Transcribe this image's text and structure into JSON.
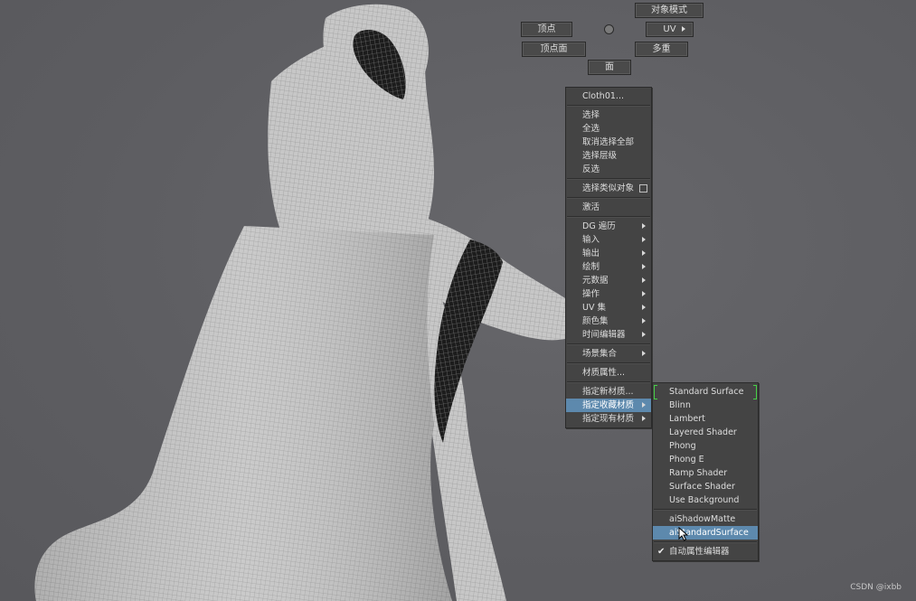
{
  "marking_menu": {
    "object_mode": "对象模式",
    "vertex": "顶点",
    "uv": "UV",
    "vertex_face": "顶点面",
    "multi": "多重",
    "face": "面"
  },
  "context_menu": {
    "header": "Cloth01...",
    "select": "选择",
    "select_all": "全选",
    "deselect_all": "取消选择全部",
    "select_hierarchy": "选择层级",
    "invert": "反选",
    "select_similar": "选择类似对象",
    "activate": "激活",
    "dg_traversal": "DG 遍历",
    "inputs": "输入",
    "outputs": "输出",
    "paint": "绘制",
    "metadata": "元数据",
    "actions": "操作",
    "uv_sets": "UV 集",
    "color_sets": "颜色集",
    "time_editor": "时间编辑器",
    "scene_assembly": "场景集合",
    "material_attributes": "材质属性...",
    "assign_new_material": "指定新材质...",
    "assign_favorite_material": "指定收藏材质",
    "assign_existing_material": "指定现有材质"
  },
  "submenu": {
    "items": [
      "Standard Surface",
      "Blinn",
      "Lambert",
      "Layered Shader",
      "Phong",
      "Phong E",
      "Ramp Shader",
      "Surface Shader",
      "Use Background"
    ],
    "arnold_items": [
      "aiShadowMatte",
      "aiStandardSurface"
    ],
    "auto_attribute_editor": "自动属性编辑器"
  },
  "watermark": "CSDN @ixbb",
  "colors": {
    "viewport_bg": "#5f5f63",
    "menu_bg": "#444444",
    "highlight": "#5d89ad",
    "bracket": "#46d046"
  },
  "icons": {
    "submenu_arrow": "triangle-right",
    "checkbox": "square-outline",
    "check": "check-mark",
    "cursor": "arrow-pointer"
  }
}
